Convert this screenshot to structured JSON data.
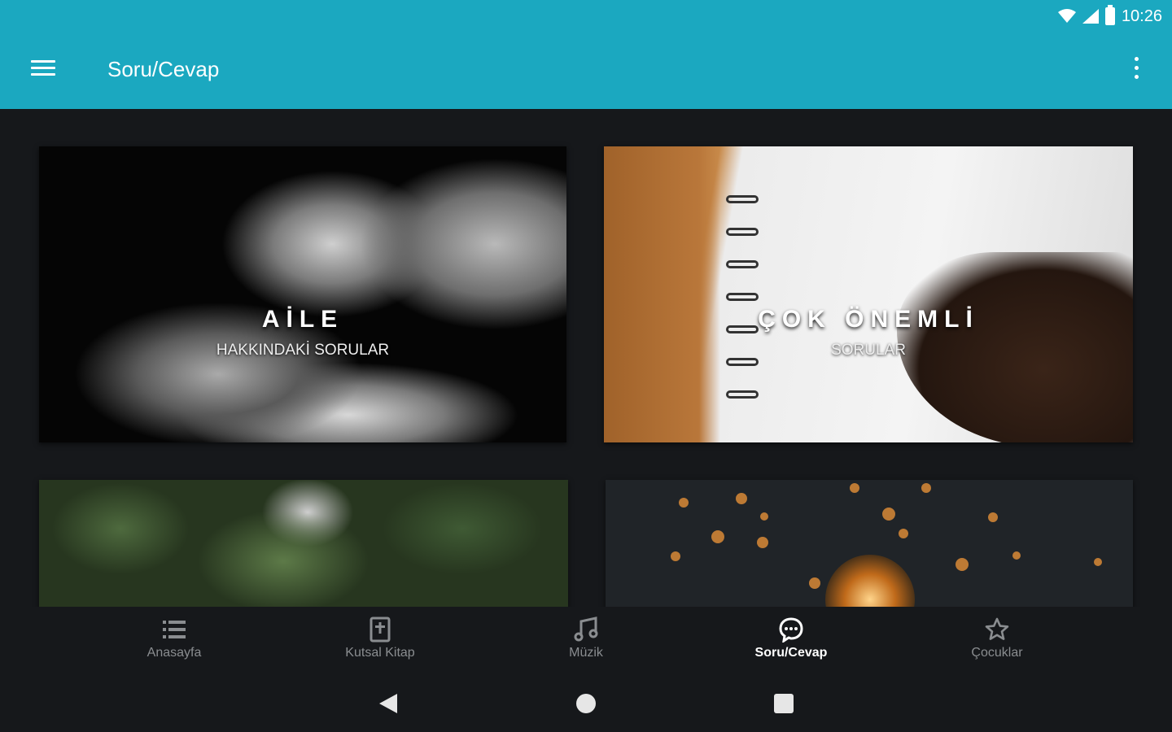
{
  "status_bar": {
    "time": "10:26"
  },
  "app_bar": {
    "title": "Soru/Cevap"
  },
  "cards": [
    {
      "title": "AİLE",
      "subtitle": "HAKKINDAKİ SORULAR"
    },
    {
      "title": "ÇOK ÖNEMLİ",
      "subtitle": "SORULAR"
    }
  ],
  "bottom_nav": [
    {
      "label": "Anasayfa",
      "icon": "list-icon",
      "active": false
    },
    {
      "label": "Kutsal Kitap",
      "icon": "bible-icon",
      "active": false
    },
    {
      "label": "Müzik",
      "icon": "music-note-icon",
      "active": false
    },
    {
      "label": "Soru/Cevap",
      "icon": "chat-bubble-icon",
      "active": true
    },
    {
      "label": "Çocuklar",
      "icon": "star-icon",
      "active": false
    }
  ],
  "colors": {
    "primary": "#1ba8c0",
    "background": "#16181b",
    "inactive": "#8a8d90",
    "active": "#ffffff"
  }
}
